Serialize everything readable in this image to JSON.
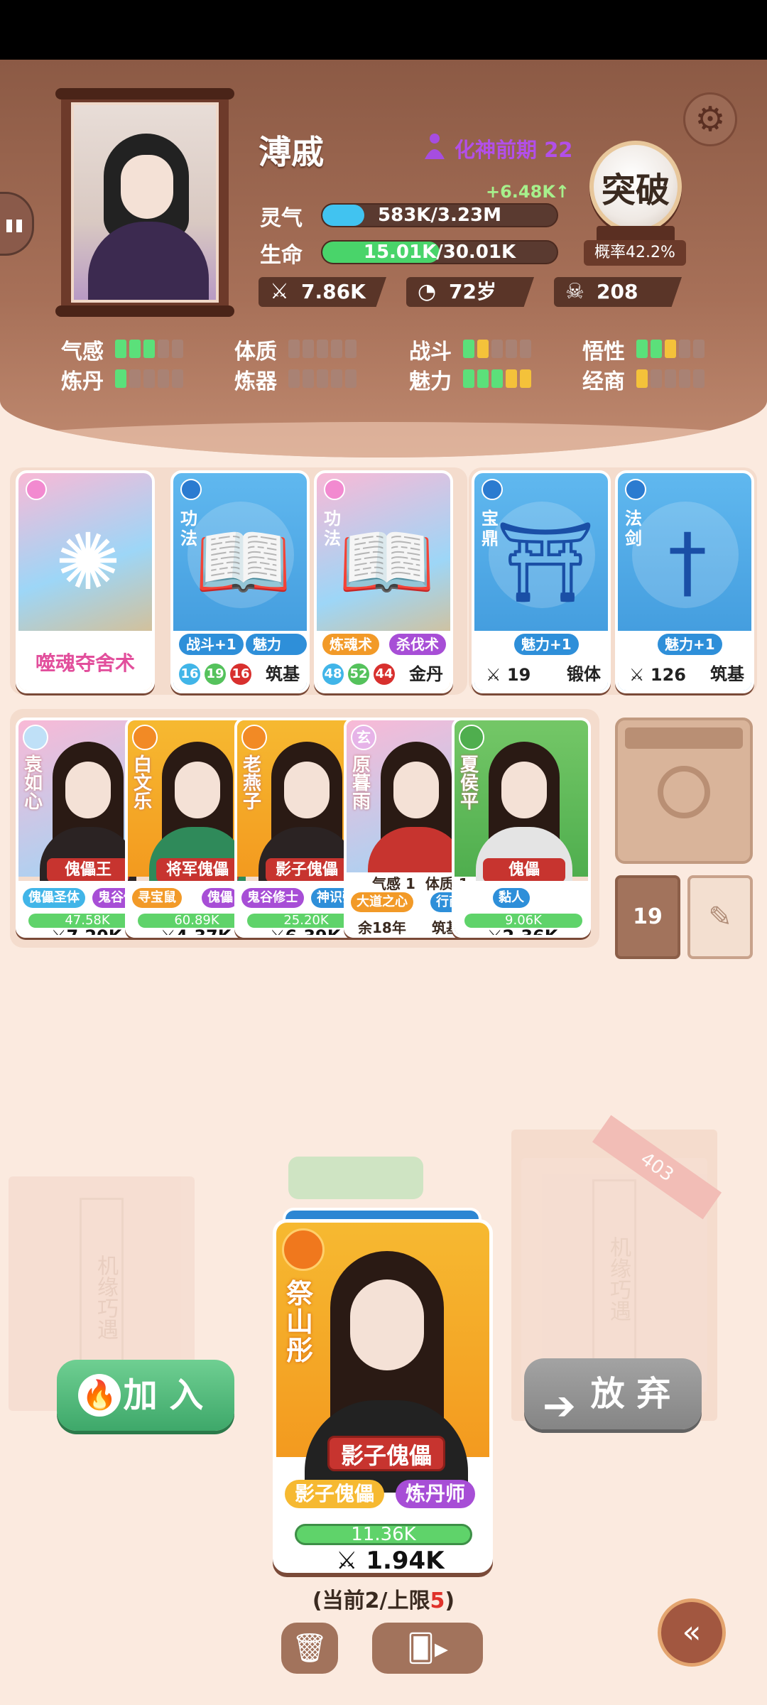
{
  "player": {
    "name": "溥戚",
    "realm": "化神前期 22",
    "spirit": {
      "label": "灵气",
      "value": "583K/3.23M",
      "gain": "+6.48K↑",
      "fraction": 0.18
    },
    "life": {
      "label": "生命",
      "value": "15.01K/30.01K",
      "fraction": 0.5
    },
    "breakthrough": {
      "label": "突破",
      "rate": "概率42.2%"
    },
    "chips": {
      "attack": "7.86K",
      "age": "72岁",
      "kills": "208"
    }
  },
  "attributes": [
    {
      "label": "气感",
      "pips": [
        "g",
        "g",
        "g",
        "n",
        "n"
      ]
    },
    {
      "label": "体质",
      "pips": [
        "n",
        "n",
        "n",
        "n",
        "n"
      ]
    },
    {
      "label": "战斗",
      "pips": [
        "g",
        "y",
        "n",
        "n",
        "n"
      ]
    },
    {
      "label": "悟性",
      "pips": [
        "g",
        "g",
        "y",
        "n",
        "n"
      ]
    },
    {
      "label": "炼丹",
      "pips": [
        "g",
        "n",
        "n",
        "n",
        "n"
      ]
    },
    {
      "label": "炼器",
      "pips": [
        "n",
        "n",
        "n",
        "n",
        "n"
      ]
    },
    {
      "label": "魅力",
      "pips": [
        "g",
        "g",
        "g",
        "y",
        "y"
      ]
    },
    {
      "label": "经商",
      "pips": [
        "y",
        "n",
        "n",
        "n",
        "n"
      ]
    }
  ],
  "skills": [
    {
      "name": "噬魂夺舍术"
    },
    {
      "type": "功法",
      "tags": [
        "战斗+1",
        "魅力+1"
      ],
      "nums": [
        "16",
        "19",
        "16"
      ],
      "rank": "筑基"
    },
    {
      "type": "功法",
      "tags": [
        "炼魂术",
        "杀伐术"
      ],
      "nums": [
        "48",
        "52",
        "44"
      ],
      "rank": "金丹"
    },
    {
      "type": "宝鼎",
      "tags": [
        "魅力+1"
      ],
      "atk": "19",
      "rank": "锻体"
    },
    {
      "type": "法剑",
      "tags": [
        "魅力+1"
      ],
      "atk": "126",
      "rank": "筑基"
    }
  ],
  "characters": [
    {
      "name": "袁如心",
      "role": "傀儡王",
      "tags": [
        "傀儡圣体",
        "鬼谷修"
      ],
      "hp": "47.58K",
      "power": "7.20K"
    },
    {
      "name": "白文乐",
      "role": "将军傀儡",
      "tags": [
        "寻宝鼠",
        "傀儡"
      ],
      "hp": "60.89K",
      "power": "4.37K"
    },
    {
      "name": "老燕子",
      "role": "影子傀儡",
      "tags": [
        "鬼谷修士",
        "神识强"
      ],
      "hp": "25.20K",
      "power": "6.39K"
    },
    {
      "name": "原暮雨",
      "emblem": "玄",
      "stats": [
        "气感",
        "1",
        "体质",
        "1"
      ],
      "tags": [
        "大道之心",
        "行商"
      ],
      "age": "余18年",
      "rank": "筑基"
    },
    {
      "name": "夏侯平",
      "role": "傀儡",
      "tags": [
        "黏人"
      ],
      "hp": "9.06K",
      "power": "2.36K"
    }
  ],
  "side": {
    "count": "19"
  },
  "deck": {
    "ghost_text": "机缘巧遇",
    "pack_count": "403",
    "card": {
      "name": "祭山彤",
      "role": "影子傀儡",
      "tags": [
        "影子傀儡",
        "炼丹师"
      ],
      "hp": "11.36K",
      "power": "1.94K"
    }
  },
  "actions": {
    "join": "加 入",
    "drop": "放 弃"
  },
  "limit": {
    "prefix": "(当前2/上限",
    "max": "5",
    "suffix": ")"
  },
  "colors": {
    "accent": "#a64de0",
    "join": "#3ea86a",
    "hp": "#5fd36a"
  }
}
